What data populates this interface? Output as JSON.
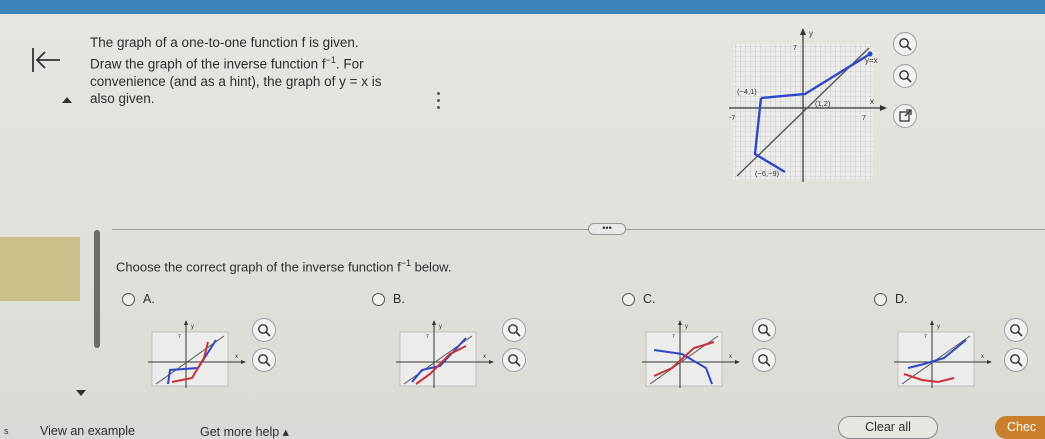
{
  "question": {
    "line1": "The graph of a one-to-one function f is given.",
    "line2_a": "Draw the graph of the inverse function f",
    "line2_sup": "−1",
    "line2_b": ". For",
    "line3": "convenience (and as a hint), the graph of y = x is",
    "line4": "also given."
  },
  "main_graph": {
    "y_axis_label": "y",
    "x_axis_label": "x",
    "y_tick": "7",
    "x_tick": "7",
    "neg_x_tick": "-7",
    "line_label": "y=x",
    "points": [
      "(−4,1)",
      "(1,2)",
      "(−6,−9)"
    ]
  },
  "more_label": "•••",
  "sub_question": {
    "text_a": "Choose the correct graph of the inverse function f",
    "text_sup": "−1",
    "text_b": " below."
  },
  "options": [
    {
      "label": "A."
    },
    {
      "label": "B."
    },
    {
      "label": "C."
    },
    {
      "label": "D."
    }
  ],
  "option_axis": {
    "y": "y",
    "x": "x",
    "tick": "7"
  },
  "footer": {
    "edge_fragment": "s",
    "view_example": "View an example",
    "get_help": "Get more help ▴",
    "clear_all": "Clear all",
    "check": "Chec"
  },
  "colors": {
    "topbar": "#3c84b8",
    "graph_blue": "#2f48c8",
    "graph_red": "#c8323a",
    "check_button": "#c97f2d"
  },
  "icons": {
    "back": "back-to-start-icon",
    "zoom_in": "zoom-in-icon",
    "zoom_out": "zoom-out-icon",
    "popout": "open-new-window-icon"
  }
}
